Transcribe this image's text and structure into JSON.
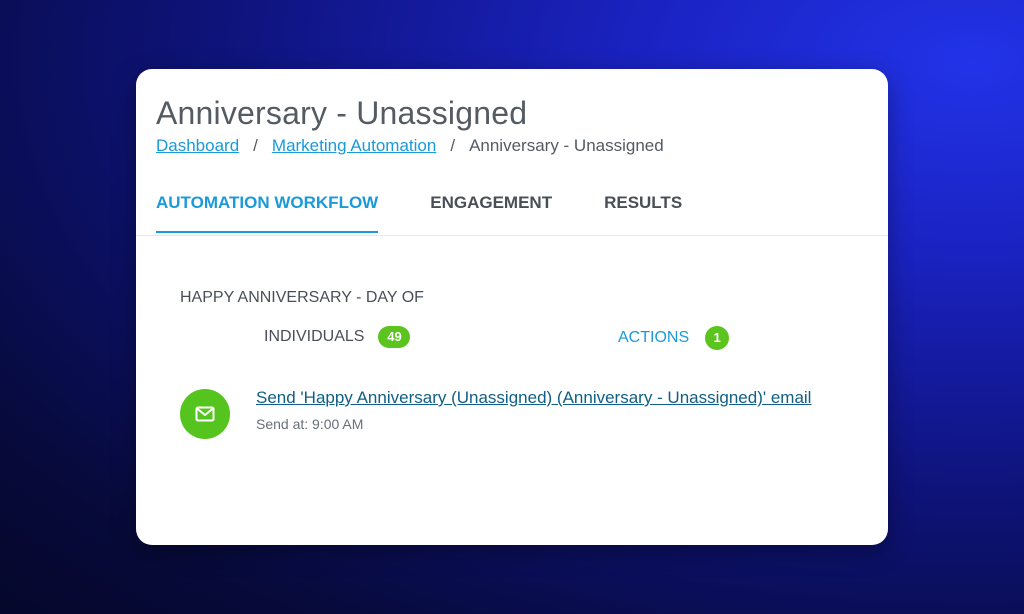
{
  "header": {
    "title": "Anniversary - Unassigned"
  },
  "breadcrumb": {
    "items": [
      {
        "label": "Dashboard"
      },
      {
        "label": "Marketing Automation"
      },
      {
        "label": "Anniversary - Unassigned"
      }
    ],
    "separator": "/"
  },
  "tabs": [
    {
      "label": "AUTOMATION WORKFLOW",
      "active": true
    },
    {
      "label": "ENGAGEMENT",
      "active": false
    },
    {
      "label": "RESULTS",
      "active": false
    }
  ],
  "workflow": {
    "step_title": "HAPPY ANNIVERSARY - DAY OF",
    "individuals_label": "INDIVIDUALS",
    "individuals_count": "49",
    "actions_label": "ACTIONS",
    "actions_count": "1",
    "action": {
      "icon": "mail-icon",
      "label": "Send 'Happy Anniversary (Unassigned) (Anniversary - Unassigned)' email",
      "send_at": "Send at: 9:00 AM"
    }
  },
  "colors": {
    "accent": "#1a9ad8",
    "badge_green": "#5cc41f",
    "background_blue": "#1a22c0"
  }
}
